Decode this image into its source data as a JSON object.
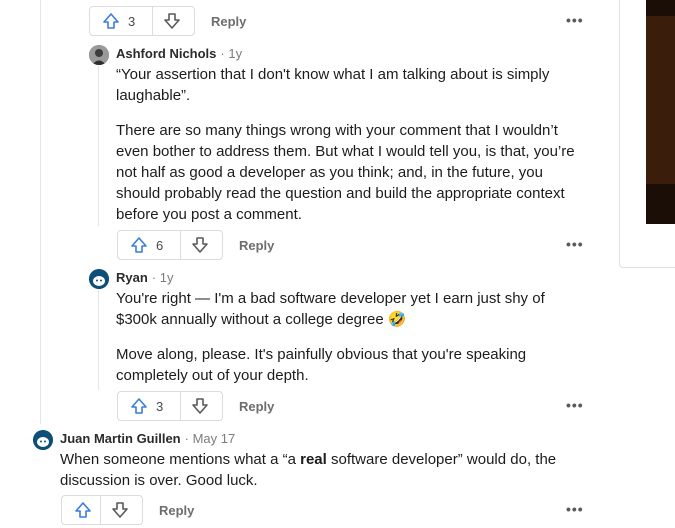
{
  "comments": [
    {
      "votes": "3",
      "reply_label": "Reply",
      "more_label": "•••"
    },
    {
      "author": "Ashford Nichols",
      "meta": "· 1y",
      "paragraphs": [
        "“Your assertion that I don't know what I am talking about is simply laughable”.",
        "There are so many things wrong with your comment that I wouldn’t even bother to address them. But what I would tell you, is that, you’re not half as good a developer as you think; and, in the future, you should probably read the question and build the appropriate context before you post a comment."
      ],
      "votes": "6",
      "reply_label": "Reply",
      "more_label": "•••"
    },
    {
      "author": "Ryan",
      "meta": "· 1y",
      "paragraphs": [
        "You're right — I'm a bad software developer yet I earn just shy of $300k annually without a college degree 🤣",
        "Move along, please. It's painfully obvious that you're speaking completely out of your depth."
      ],
      "votes": "3",
      "reply_label": "Reply",
      "more_label": "•••"
    },
    {
      "author": "Juan Martin Guillen",
      "meta": "· May 17",
      "text_before": "When someone mentions what a “a ",
      "text_bold": "real",
      "text_after": " software developer” would do, the discussion is over. Good luck.",
      "votes": "",
      "reply_label": "Reply",
      "more_label": "•••"
    }
  ],
  "colors": {
    "upvote": "#3b7dd8",
    "text": "#1c1c1c",
    "meta": "#7c7c7c",
    "reddit_avatar_bg": "#0e4f7a"
  },
  "icons": {
    "upvote": "upvote-arrow-icon",
    "downvote": "downvote-arrow-icon",
    "avatar": "snoo-avatar-icon"
  }
}
